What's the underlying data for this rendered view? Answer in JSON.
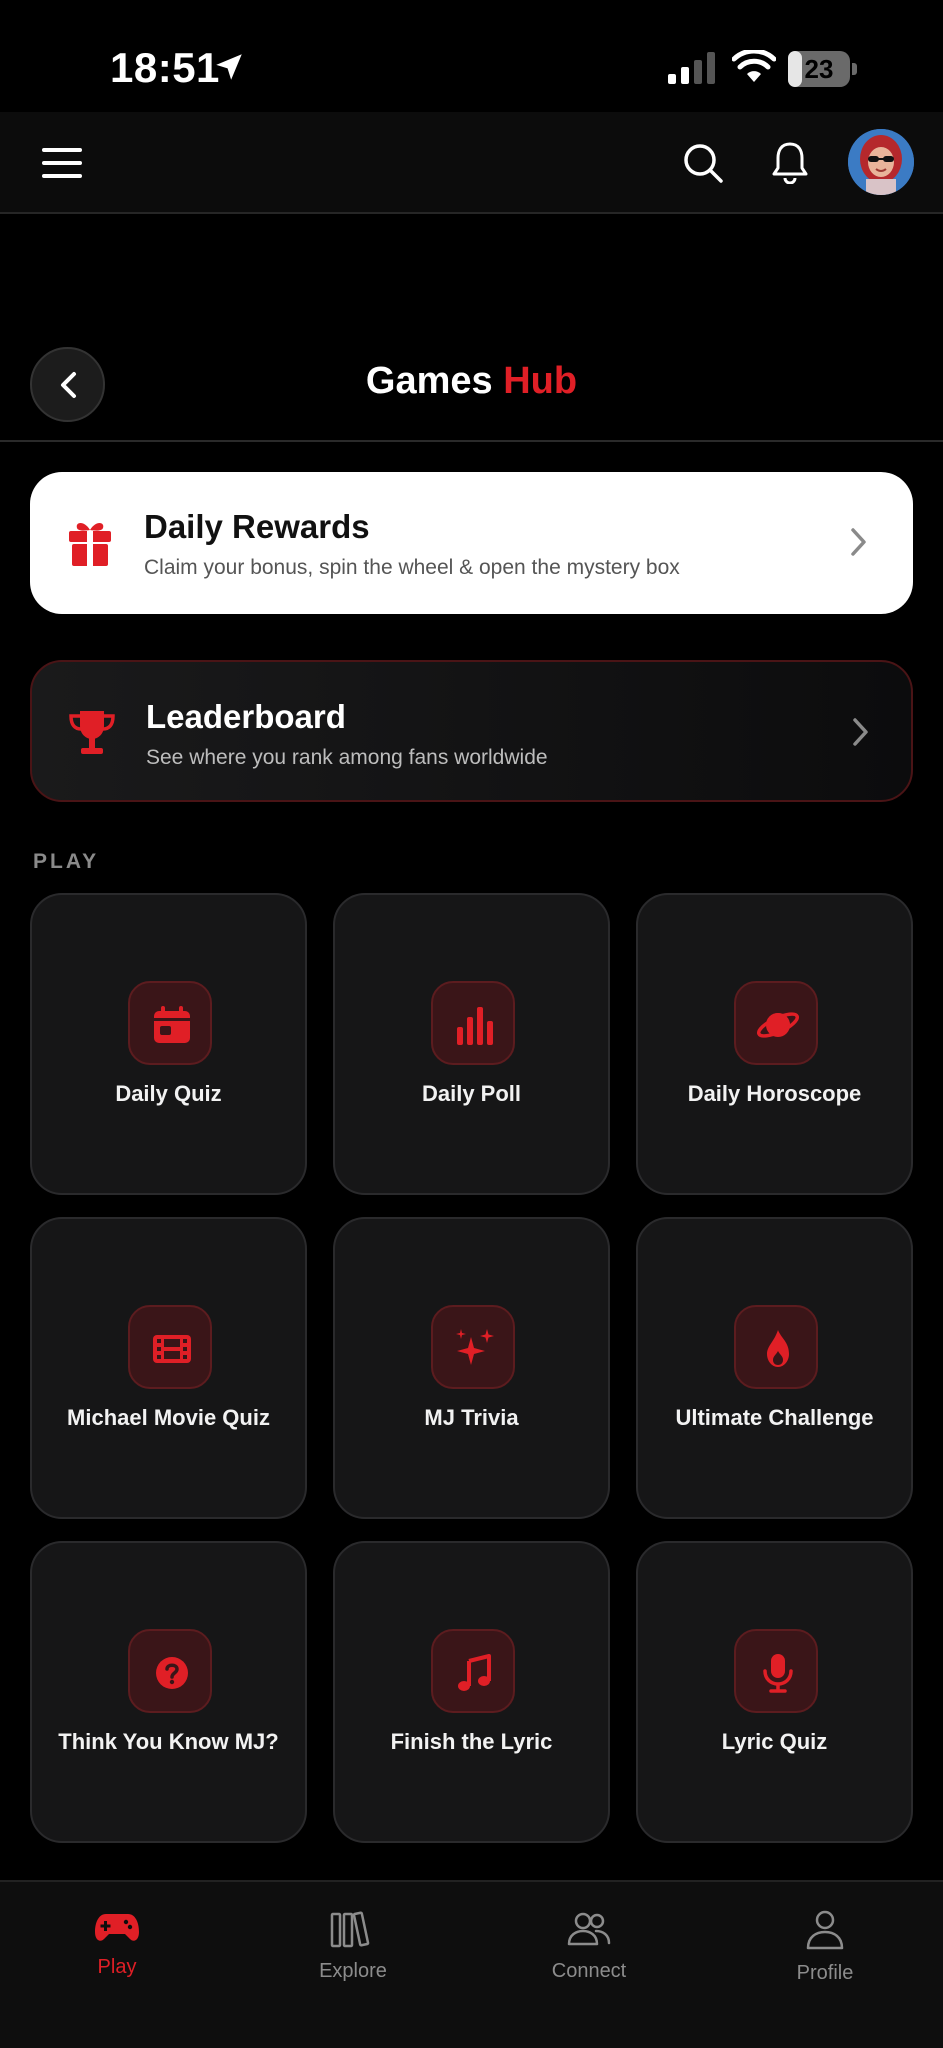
{
  "status_bar": {
    "time": "18:51",
    "battery": "23",
    "battery_level": 0.23
  },
  "header": {
    "menu_icon": "hamburger-menu-icon",
    "search_icon": "search-icon",
    "notifications_icon": "bell-icon",
    "avatar_icon": "user-avatar"
  },
  "page": {
    "title_main": "Games ",
    "title_accent": "Hub"
  },
  "cards": {
    "daily_rewards": {
      "title": "Daily Rewards",
      "subtitle": "Claim your bonus, spin the wheel & open the mystery box",
      "icon": "gift-icon"
    },
    "leaderboard": {
      "title": "Leaderboard",
      "subtitle": "See where you rank among fans worldwide",
      "icon": "trophy-icon"
    }
  },
  "section": {
    "play_label": "PLAY"
  },
  "games": [
    {
      "label": "Daily Quiz",
      "icon": "calendar-icon"
    },
    {
      "label": "Daily Poll",
      "icon": "bar-chart-icon"
    },
    {
      "label": "Daily Horoscope",
      "icon": "planet-icon"
    },
    {
      "label": "Michael Movie Quiz",
      "icon": "film-icon"
    },
    {
      "label": "MJ Trivia",
      "icon": "sparkles-icon"
    },
    {
      "label": "Ultimate Challenge",
      "icon": "flame-icon"
    },
    {
      "label": "Think You Know MJ?",
      "icon": "question-icon"
    },
    {
      "label": "Finish the Lyric",
      "icon": "music-note-icon"
    },
    {
      "label": "Lyric Quiz",
      "icon": "microphone-icon"
    }
  ],
  "bottom_nav": [
    {
      "label": "Play",
      "icon": "gamepad-icon",
      "active": true
    },
    {
      "label": "Explore",
      "icon": "library-icon",
      "active": false
    },
    {
      "label": "Connect",
      "icon": "users-icon",
      "active": false
    },
    {
      "label": "Profile",
      "icon": "person-icon",
      "active": false
    }
  ],
  "colors": {
    "accent": "#e01f26",
    "background": "#000000",
    "tile": "#161617"
  }
}
